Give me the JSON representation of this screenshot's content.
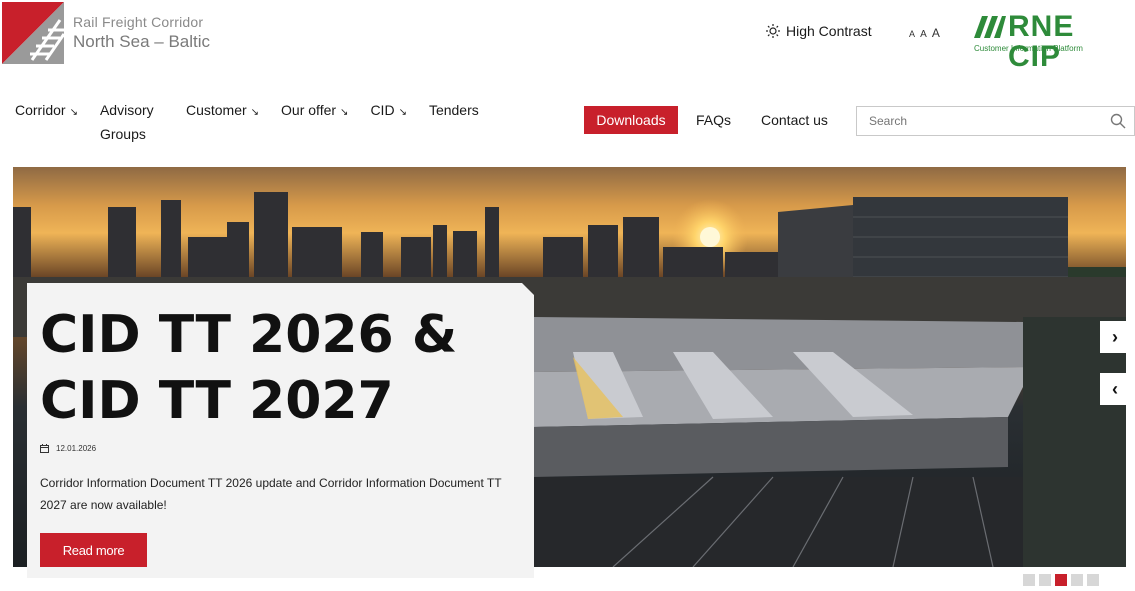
{
  "brand": {
    "line1": "Rail Freight Corridor",
    "line2": "North Sea – Baltic"
  },
  "accessibility": {
    "high_contrast_label": "High Contrast",
    "font_sizes": [
      "A",
      "A",
      "A"
    ]
  },
  "rne": {
    "title": "RNE CIP",
    "subtitle": "Customer Information Platform"
  },
  "nav": {
    "items": [
      {
        "label": "Corridor",
        "arrow": "↘"
      },
      {
        "label": "Advisory Groups",
        "arrow": ""
      },
      {
        "label": "Customer",
        "arrow": "↘"
      },
      {
        "label": "Our offer",
        "arrow": "↘"
      },
      {
        "label": "CID",
        "arrow": "↘"
      },
      {
        "label": "Tenders",
        "arrow": ""
      }
    ],
    "downloads_label": "Downloads",
    "faqs_label": "FAQs",
    "contact_label": "Contact us"
  },
  "search": {
    "placeholder": "Search",
    "value": ""
  },
  "hero": {
    "title": "CID TT 2026 & CID TT 2027",
    "date": "12.01.2026",
    "description": "Corridor Information Document TT 2026 update and Corridor Information Document TT 2027 are now available!",
    "read_more_label": "Read more",
    "next_glyph": "›",
    "prev_glyph": "‹",
    "slides_total": 5,
    "active_slide": 3
  },
  "colors": {
    "accent": "#c8202b",
    "rne_green": "#2e8b3a"
  }
}
